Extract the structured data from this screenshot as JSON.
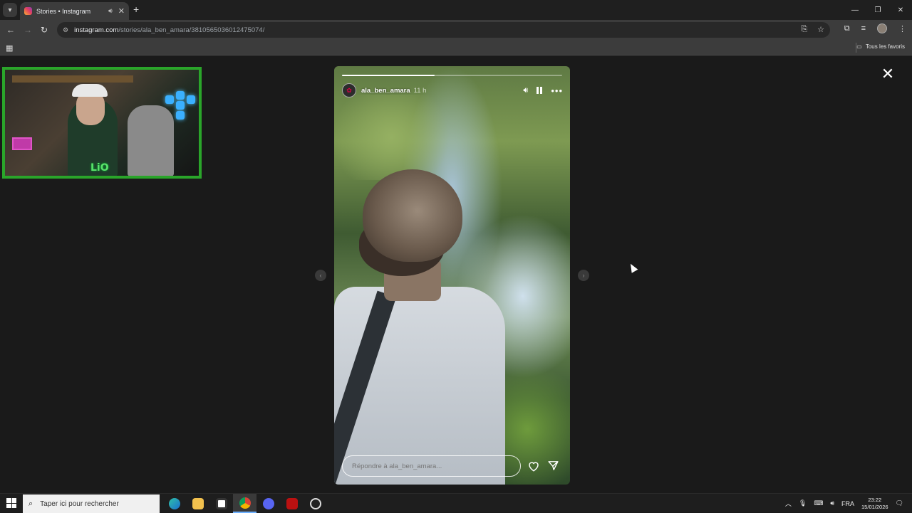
{
  "browser": {
    "tab": {
      "title": "Stories • Instagram"
    },
    "url": {
      "host": "instagram.com",
      "path": "/stories/ala_ben_amara/3810565036012475074/"
    },
    "bookmarks": {
      "all_favorites": "Tous les favoris"
    }
  },
  "story": {
    "username": "ala_ben_amara",
    "time_ago": "11 h",
    "progress": 0.42,
    "reply_placeholder": "Répondre à ala_ben_amara..."
  },
  "taskbar": {
    "search_placeholder": "Taper ici pour rechercher",
    "language": "FRA",
    "time": "23:22",
    "date": "15/01/2026"
  },
  "colors": {
    "webcam_border": "#2aa52a",
    "accent": "#6cb0ff",
    "instagram_gradient_start": "#f9b233",
    "instagram_gradient_end": "#8a3ab9"
  },
  "icons": {
    "tab_list": "chevron-down-icon",
    "favicon": "instagram-icon",
    "audio": "speaker-icon",
    "back": "arrow-left-icon",
    "forward": "arrow-right-icon",
    "reload": "reload-icon",
    "site_info": "tune-icon",
    "install": "install-app-icon",
    "star": "star-icon",
    "extensions": "puzzle-icon",
    "media": "media-control-icon",
    "menu": "kebab-menu-icon",
    "apps": "apps-grid-icon",
    "folder": "folder-icon",
    "close": "close-icon",
    "like": "heart-icon",
    "share": "send-icon",
    "mute": "volume-icon",
    "pause": "pause-icon",
    "more": "more-horizontal-icon"
  }
}
